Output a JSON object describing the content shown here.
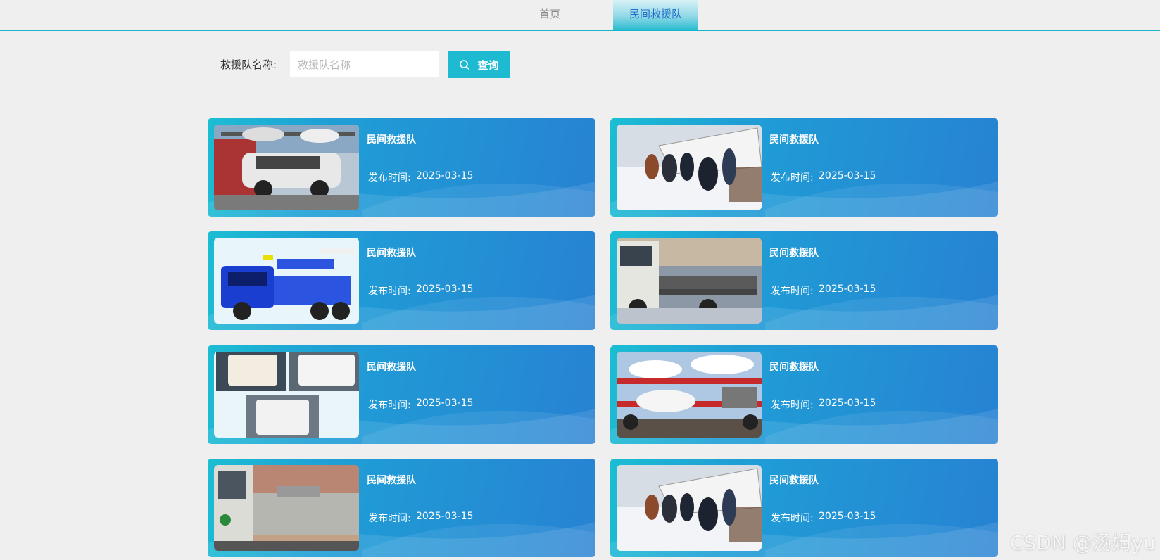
{
  "nav": {
    "items": [
      {
        "label": "首页"
      },
      {
        "label": "民间救援队"
      }
    ],
    "active_color": "#1f6fc9"
  },
  "search": {
    "label": "救援队名称:",
    "placeholder": "救援队名称",
    "value": "",
    "button_label": "查询",
    "button_icon": "search-icon",
    "accent": "#1dbad2"
  },
  "cards": [
    {
      "title": "民间救援队",
      "date_label": "发布时间:",
      "date": "2025-03-15",
      "image": "car-carrier-photo"
    },
    {
      "title": "民间救援队",
      "date_label": "发布时间:",
      "date": "2025-03-15",
      "image": "people-pushing-van-in-snow-photo"
    },
    {
      "title": "民间救援队",
      "date_label": "发布时间:",
      "date": "2025-03-15",
      "image": "blue-tow-truck-toy-photo"
    },
    {
      "title": "民间救援队",
      "date_label": "发布时间:",
      "date": "2025-03-15",
      "image": "flatbed-tow-truck-street-photo"
    },
    {
      "title": "民间救援队",
      "date_label": "发布时间:",
      "date": "2025-03-15",
      "image": "jac-trucks-collage-photo"
    },
    {
      "title": "民间救援队",
      "date_label": "发布时间:",
      "date": "2025-03-15",
      "image": "red-car-carrier-photo"
    },
    {
      "title": "民间救援队",
      "date_label": "发布时间:",
      "date": "2025-03-15",
      "image": "wrecker-tow-truck-photo"
    },
    {
      "title": "民间救援队",
      "date_label": "发布时间:",
      "date": "2025-03-15",
      "image": "people-pushing-van-in-snow-photo"
    }
  ],
  "watermark": "CSDN @汤姆yu"
}
